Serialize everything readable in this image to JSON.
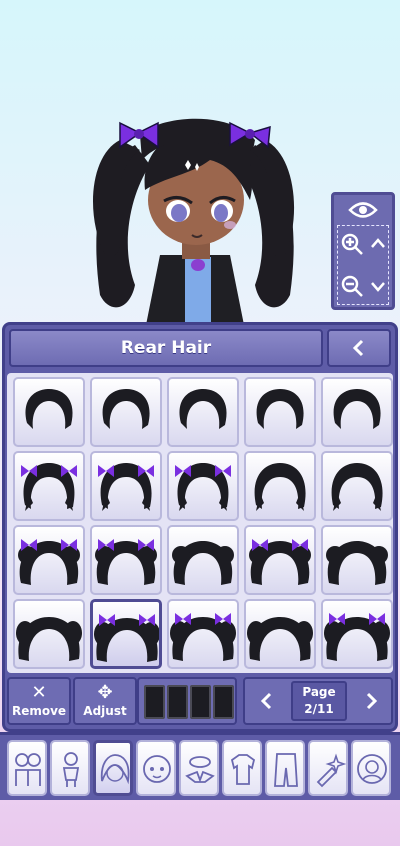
{
  "panel": {
    "title": "Rear Hair",
    "back_label": "<"
  },
  "zoom": {
    "view_icon": "eye-icon",
    "zoom_in_icon": "zoom-in-icon",
    "zoom_out_icon": "zoom-out-icon",
    "up_icon": "chevron-up-icon",
    "down_icon": "chevron-down-icon"
  },
  "hair_grid": {
    "rows": 4,
    "columns": 5,
    "selected_index": 16,
    "items_with_purple_bows": [
      5,
      6,
      7,
      10,
      11,
      13,
      16,
      17,
      19
    ]
  },
  "controls": {
    "remove_label": "Remove",
    "remove_glyph": "✕",
    "adjust_label": "Adjust",
    "adjust_glyph": "✥",
    "color_swatches": [
      "#1c1c22",
      "#1c1c22",
      "#1c1c22",
      "#1c1c22"
    ],
    "prev_glyph": "<",
    "next_glyph": ">",
    "page_label": "Page",
    "page_value": "2/11"
  },
  "tabs": [
    {
      "icon": "characters-icon",
      "active": false
    },
    {
      "icon": "body-icon",
      "active": false
    },
    {
      "icon": "hair-icon",
      "active": true
    },
    {
      "icon": "face-icon",
      "active": false
    },
    {
      "icon": "hat-icon",
      "active": false
    },
    {
      "icon": "top-icon",
      "active": false
    },
    {
      "icon": "bottom-icon",
      "active": false
    },
    {
      "icon": "props-icon",
      "active": false
    },
    {
      "icon": "profile-icon",
      "active": false
    }
  ],
  "colors": {
    "panel": "#5e5ca7",
    "panel_border": "#41408a",
    "hair": "#1c1c22",
    "bow": "#7a2fe0"
  }
}
